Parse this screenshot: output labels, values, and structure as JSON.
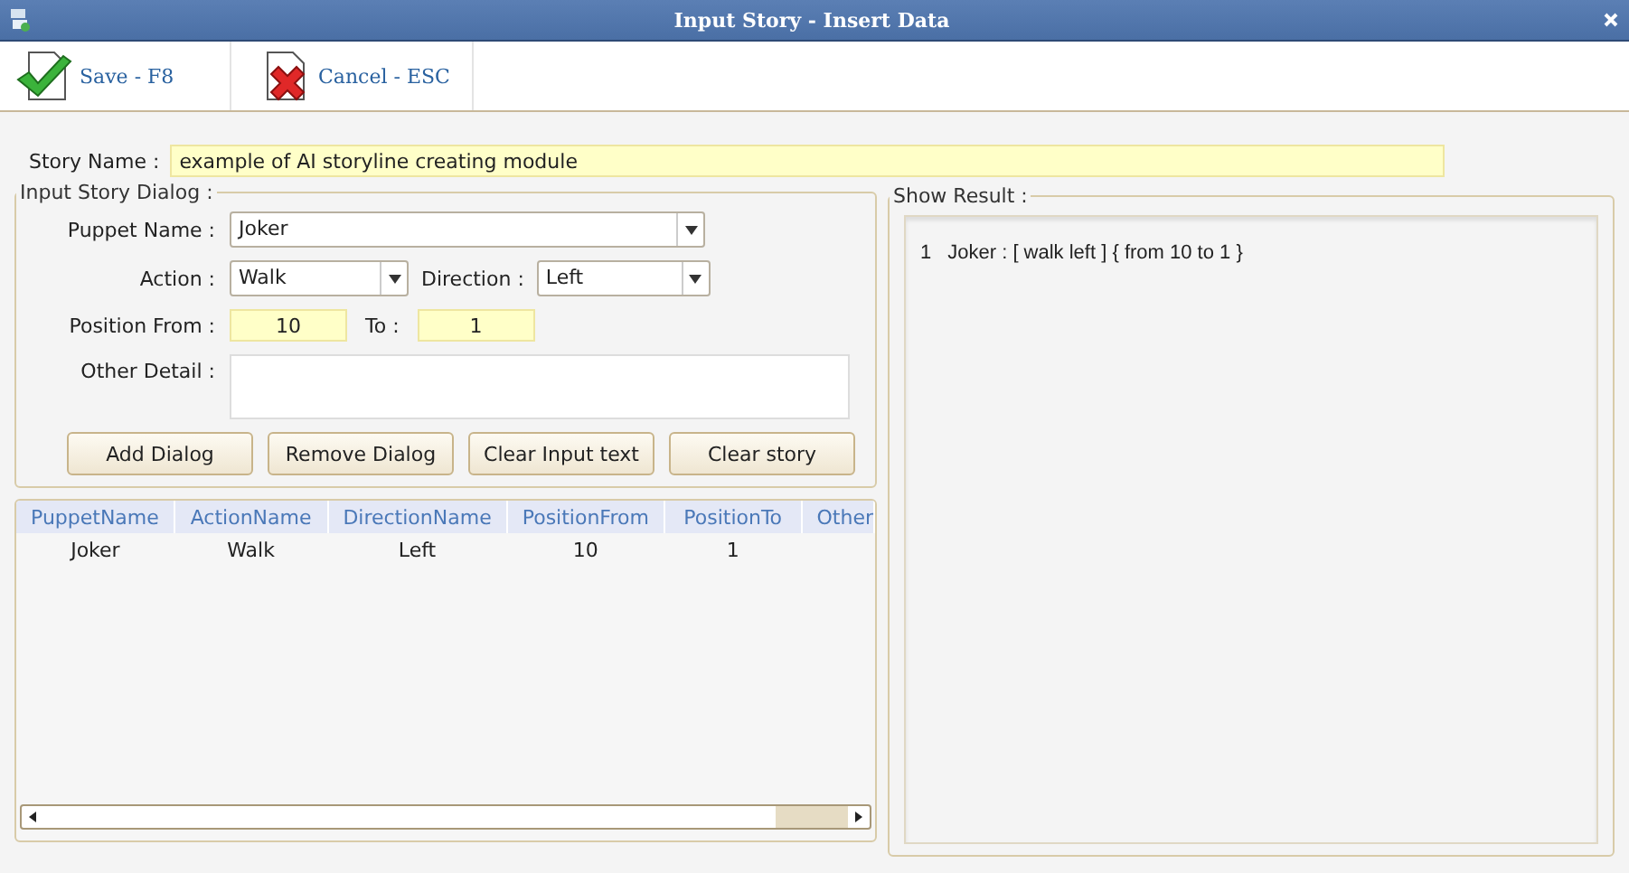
{
  "window": {
    "title": "Input Story - Insert Data"
  },
  "toolbar": [
    {
      "kind": "save",
      "label": "Save - F8"
    },
    {
      "kind": "cancel",
      "label": "Cancel - ESC"
    }
  ],
  "story_name": {
    "label": "Story Name :",
    "value": "example of AI storyline creating module"
  },
  "dialog_group": {
    "title": "Input Story Dialog :",
    "puppet": {
      "label": "Puppet Name :",
      "value": "Joker"
    },
    "action": {
      "label": "Action :",
      "value": "Walk"
    },
    "direction": {
      "label": "Direction :",
      "value": "Left"
    },
    "position_from": {
      "label": "Position From :",
      "value": "10"
    },
    "position_to": {
      "label": "To :",
      "value": "1"
    },
    "other_detail": {
      "label": "Other Detail :"
    },
    "buttons": [
      "Add Dialog",
      "Remove Dialog",
      "Clear Input text",
      "Clear story"
    ]
  },
  "table": {
    "columns": [
      "PuppetName",
      "ActionName",
      "DirectionName",
      "PositionFrom",
      "PositionTo",
      "Other"
    ],
    "rows": [
      {
        "cells": [
          "Joker",
          "Walk",
          "Left",
          "10",
          "1"
        ]
      }
    ]
  },
  "result": {
    "title": "Show Result :",
    "lines": [
      {
        "number": "1",
        "text": "Joker : [ walk left ] { from 10 to 1 }"
      }
    ]
  }
}
